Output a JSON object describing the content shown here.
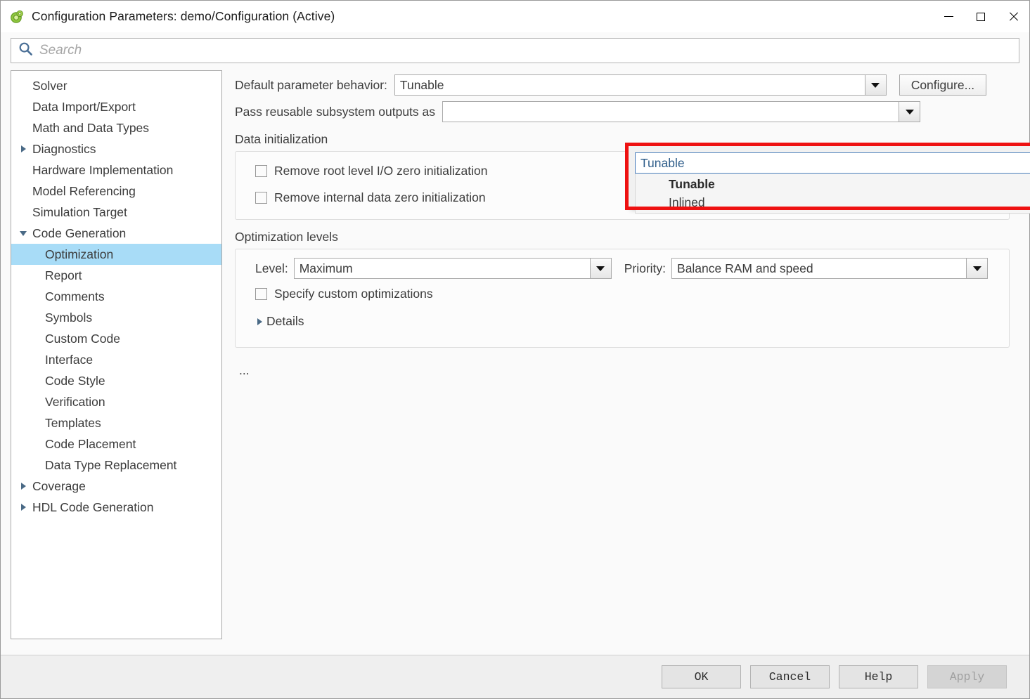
{
  "window": {
    "title": "Configuration Parameters: demo/Configuration (Active)",
    "app_icon": "simulink-gear-icon",
    "minimize_label": "Minimize",
    "maximize_label": "Maximize",
    "close_label": "Close"
  },
  "search": {
    "placeholder": "Search",
    "value": "",
    "icon": "search-icon"
  },
  "sidebar": {
    "items": [
      {
        "label": "Solver",
        "level": 0,
        "arrow": "none",
        "selected": false
      },
      {
        "label": "Data Import/Export",
        "level": 0,
        "arrow": "none",
        "selected": false
      },
      {
        "label": "Math and Data Types",
        "level": 0,
        "arrow": "none",
        "selected": false
      },
      {
        "label": "Diagnostics",
        "level": 0,
        "arrow": "right",
        "selected": false
      },
      {
        "label": "Hardware Implementation",
        "level": 0,
        "arrow": "none",
        "selected": false
      },
      {
        "label": "Model Referencing",
        "level": 0,
        "arrow": "none",
        "selected": false
      },
      {
        "label": "Simulation Target",
        "level": 0,
        "arrow": "none",
        "selected": false
      },
      {
        "label": "Code Generation",
        "level": 0,
        "arrow": "down",
        "selected": false
      },
      {
        "label": "Optimization",
        "level": 1,
        "arrow": "none",
        "selected": true
      },
      {
        "label": "Report",
        "level": 1,
        "arrow": "none",
        "selected": false
      },
      {
        "label": "Comments",
        "level": 1,
        "arrow": "none",
        "selected": false
      },
      {
        "label": "Symbols",
        "level": 1,
        "arrow": "none",
        "selected": false
      },
      {
        "label": "Custom Code",
        "level": 1,
        "arrow": "none",
        "selected": false
      },
      {
        "label": "Interface",
        "level": 1,
        "arrow": "none",
        "selected": false
      },
      {
        "label": "Code Style",
        "level": 1,
        "arrow": "none",
        "selected": false
      },
      {
        "label": "Verification",
        "level": 1,
        "arrow": "none",
        "selected": false
      },
      {
        "label": "Templates",
        "level": 1,
        "arrow": "none",
        "selected": false
      },
      {
        "label": "Code Placement",
        "level": 1,
        "arrow": "none",
        "selected": false
      },
      {
        "label": "Data Type Replacement",
        "level": 1,
        "arrow": "none",
        "selected": false
      },
      {
        "label": "Coverage",
        "level": 0,
        "arrow": "right",
        "selected": false
      },
      {
        "label": "HDL Code Generation",
        "level": 0,
        "arrow": "right",
        "selected": false
      }
    ]
  },
  "main": {
    "default_parameter_behavior": {
      "label": "Default parameter behavior:",
      "value": "Tunable",
      "options": [
        "Tunable",
        "Inlined"
      ],
      "selected_option": "Tunable",
      "configure_button": "Configure..."
    },
    "pass_reusable": {
      "label": "Pass reusable subsystem outputs as",
      "value": ""
    },
    "data_initialization": {
      "title": "Data initialization",
      "checkboxes": [
        {
          "label": "Remove root level I/O zero initialization",
          "checked": false
        },
        {
          "label": "Remove internal data zero initialization",
          "checked": false
        }
      ]
    },
    "optimization_levels": {
      "title": "Optimization levels",
      "level_label": "Level:",
      "level_value": "Maximum",
      "priority_label": "Priority:",
      "priority_value": "Balance RAM and speed",
      "custom_checkbox": {
        "label": "Specify custom optimizations",
        "checked": false
      },
      "details_label": "Details",
      "details_expanded": false
    },
    "overflow_text": "..."
  },
  "footer": {
    "ok": "OK",
    "cancel": "Cancel",
    "help": "Help",
    "apply": "Apply",
    "apply_enabled": false
  },
  "colors": {
    "highlight_border": "#ee1111",
    "tree_selection": "#a8dcf7",
    "combo_focus_border": "#4a7ebb",
    "search_icon": "#4a6f96"
  }
}
